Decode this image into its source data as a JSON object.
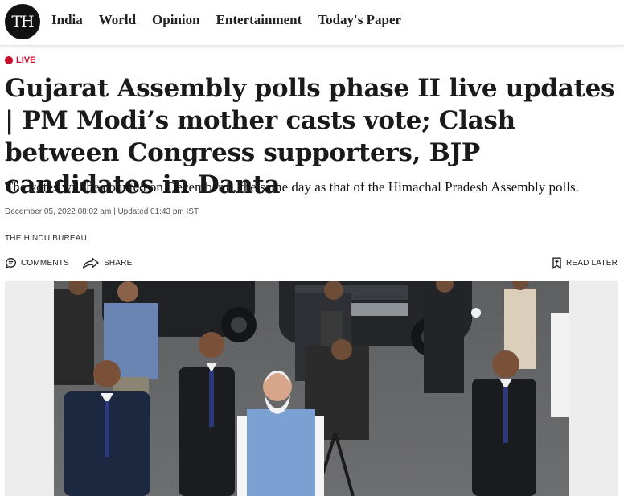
{
  "brand": {
    "logo_text": "TH"
  },
  "nav": {
    "items": [
      {
        "label": "India"
      },
      {
        "label": "World"
      },
      {
        "label": "Opinion"
      },
      {
        "label": "Entertainment"
      },
      {
        "label": "Today's Paper"
      }
    ]
  },
  "article": {
    "live_label": "LIVE",
    "headline": "Gujarat Assembly polls phase II live updates | PM Modi’s mother casts vote; Clash between Congress supporters, BJP candidates in Danta",
    "subhead": "The votes will be counted on December 8, the same day as that of the Himachal Pradesh Assembly polls.",
    "dateline": "December 05, 2022 08:02 am | Updated 01:43 pm IST",
    "byline": "THE HINDU BUREAU"
  },
  "actions": {
    "comments_label": "COMMENTS",
    "share_label": "SHARE",
    "read_later_label": "READ LATER"
  },
  "colors": {
    "live_accent": "#c8102e",
    "photo_background": "#ededed"
  },
  "icons": [
    "comment-icon",
    "share-icon",
    "bookmark-icon"
  ]
}
